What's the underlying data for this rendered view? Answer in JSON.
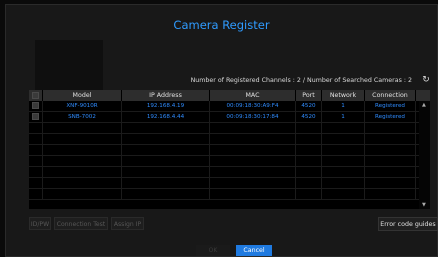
{
  "dialog": {
    "title": "Camera Register"
  },
  "summary": {
    "text": "Number of Registered Channels : 2 / Number of Searched Cameras : 2",
    "refresh_icon": "refresh-icon"
  },
  "table": {
    "headers": [
      "",
      "Model",
      "IP Address",
      "MAC",
      "Port",
      "Network",
      "Connection"
    ],
    "rows": [
      {
        "model": "XNF-9010R",
        "ip": "192.168.4.19",
        "mac": "00:09:18:30:A9:F4",
        "port": "4520",
        "network": "1",
        "connection": "Registered"
      },
      {
        "model": "SNB-7002",
        "ip": "192.168.4.44",
        "mac": "00:09:18:30:17:84",
        "port": "4520",
        "network": "1",
        "connection": "Registered"
      }
    ],
    "empty_rows": 7
  },
  "buttons": {
    "idpw": "ID/PW",
    "connection_test": "Connection Test",
    "assign_ip": "Assign IP",
    "error_code_guides": "Error code guides",
    "ok": "OK",
    "cancel": "Cancel"
  },
  "colors": {
    "accent": "#2f9bff",
    "primary_button": "#1f7ae0",
    "background": "#181818"
  }
}
